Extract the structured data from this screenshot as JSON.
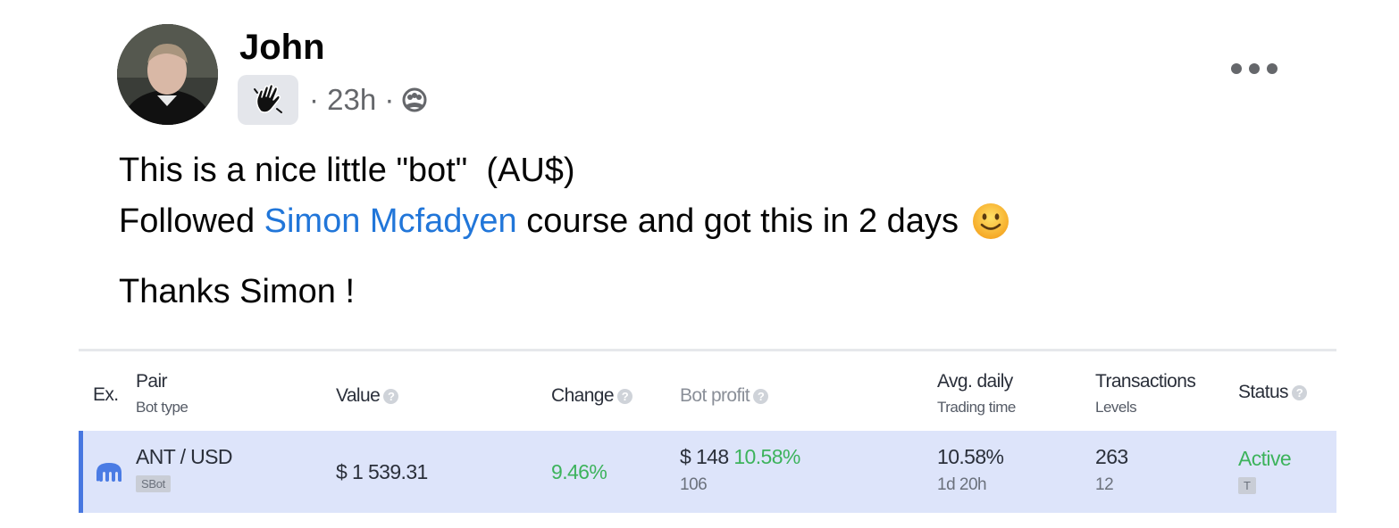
{
  "post": {
    "author": "John",
    "time": "· 23h ·",
    "badge_icon": "waving-hand-icon",
    "audience_icon": "group-members-icon",
    "more_icon": "more-options-icon",
    "line1": "This is a nice little \"bot\"  (AU$)",
    "line2_before": "Followed ",
    "line2_mention": "Simon Mcfadyen",
    "line2_after": " course and got this in 2 days",
    "line2_emoji": "slightly-smiling-face-icon",
    "line3": "Thanks Simon !"
  },
  "table": {
    "headers": {
      "ex": "Ex.",
      "pair": "Pair",
      "pair_sub": "Bot type",
      "value": "Value",
      "change": "Change",
      "bot_profit": "Bot profit",
      "avg_daily": "Avg. daily",
      "avg_daily_sub": "Trading time",
      "transactions": "Transactions",
      "transactions_sub": "Levels",
      "status": "Status",
      "help_glyph": "?"
    },
    "row": {
      "exchange_icon": "kraken-exchange-icon",
      "pair": "ANT / USD",
      "bot_type": "SBot",
      "value": "$ 1 539.31",
      "change": "9.46%",
      "bot_profit": "$ 148",
      "bot_profit_pct": "10.58%",
      "bot_profit_sub": "106",
      "avg_daily": "10.58%",
      "trading_time": "1d 20h",
      "transactions": "263",
      "levels": "12",
      "status": "Active",
      "status_tag": "T"
    },
    "colors": {
      "row_bg": "#dde4fa",
      "row_accent": "#4777e0",
      "positive": "#3db35c",
      "mention": "#2176d9"
    }
  }
}
